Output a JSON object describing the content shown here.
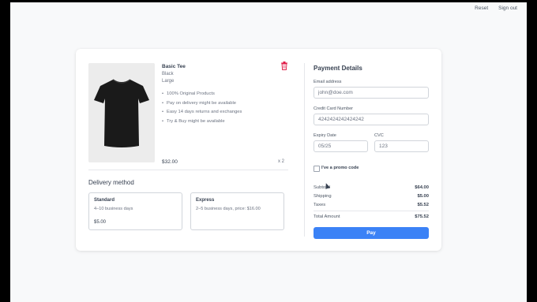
{
  "topnav": {
    "reset": "Reset",
    "signout": "Sign out"
  },
  "product": {
    "name": "Basic Tee",
    "color": "Black",
    "size": "Large",
    "features": [
      "100% Original Products",
      "Pay on delivery might be available",
      "Easy 14 days returns and exchanges",
      "Try & Buy might be available"
    ],
    "price": "$32.00",
    "quantity": "x 2"
  },
  "delivery": {
    "title": "Delivery method",
    "options": [
      {
        "title": "Standard",
        "desc": "4–10 business days",
        "price": "$5.00"
      },
      {
        "title": "Express",
        "desc": "2–5 business days, price: $16.00",
        "price": ""
      }
    ]
  },
  "payment": {
    "title": "Payment Details",
    "email_label": "Email address",
    "email_value": "john@doe.com",
    "card_label": "Credit Card Number",
    "card_value": "4242424242424242",
    "expiry_label": "Expiry Date",
    "expiry_value": "05/25",
    "cvc_label": "CVC",
    "cvc_value": "123",
    "promo_label": "I've a promo code"
  },
  "summary": {
    "subtotal_label": "Subtotal",
    "subtotal": "$64.00",
    "shipping_label": "Shipping",
    "shipping": "$5.00",
    "taxes_label": "Taxes",
    "taxes": "$5.52",
    "total_label": "Total Amount",
    "total": "$75.52"
  },
  "pay_button": "Pay",
  "colors": {
    "accent": "#3b82f6",
    "trash": "#e11d48"
  }
}
